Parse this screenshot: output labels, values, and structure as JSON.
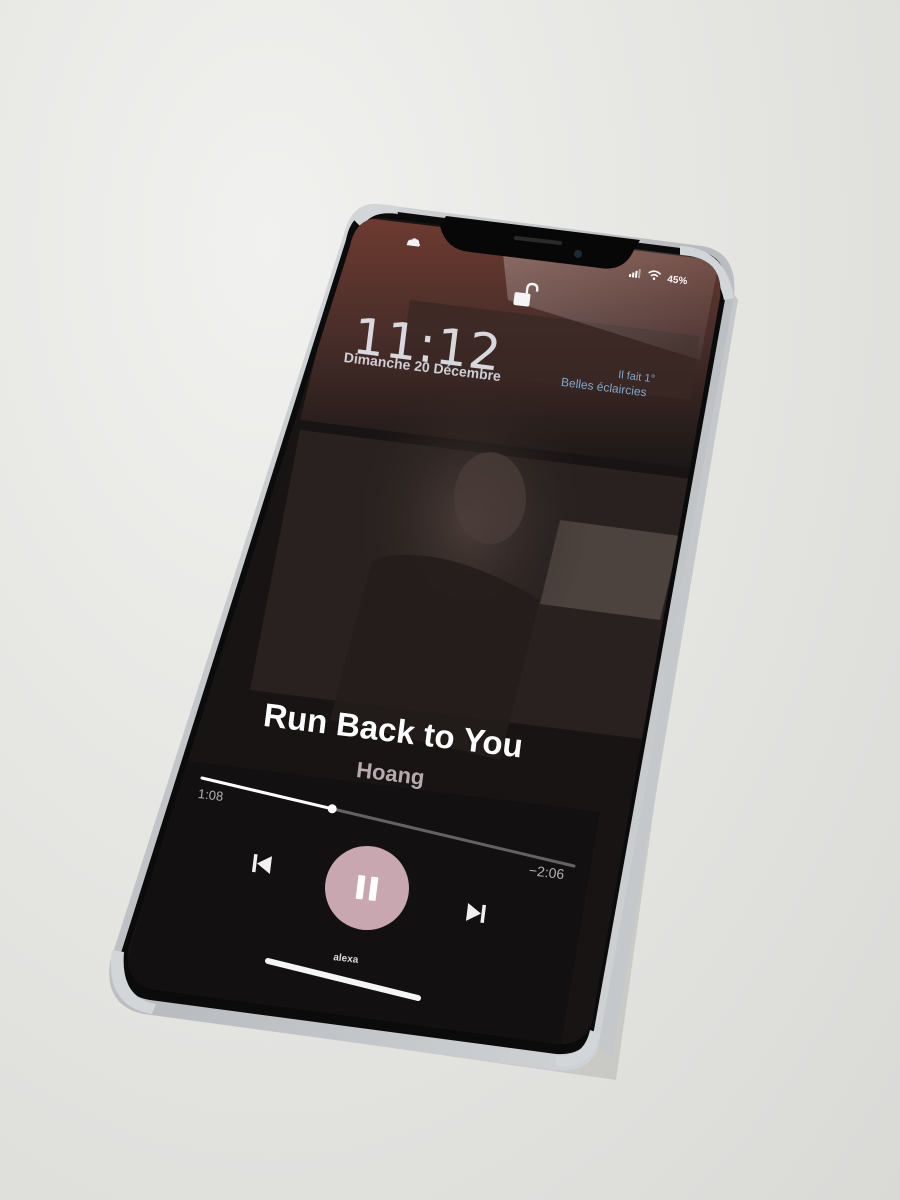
{
  "lock_screen": {
    "time": "11:12",
    "date": "Dimanche 20 Décembre",
    "weather_line1": "Il fait 1°",
    "weather_line2": "Belles éclaircies",
    "battery_percent": "45%"
  },
  "now_playing": {
    "title": "Run Back to You",
    "artist": "Hoang",
    "elapsed": "1:08",
    "remaining": "−2:06",
    "progress_fraction": 0.35,
    "output_device": "alexa",
    "accent_color": "#c9a7b0"
  },
  "icons": [
    "cloud-icon",
    "signal-bars-icon",
    "wifi-icon",
    "unlocked-padlock-icon",
    "previous-track-icon",
    "pause-icon",
    "next-track-icon"
  ]
}
